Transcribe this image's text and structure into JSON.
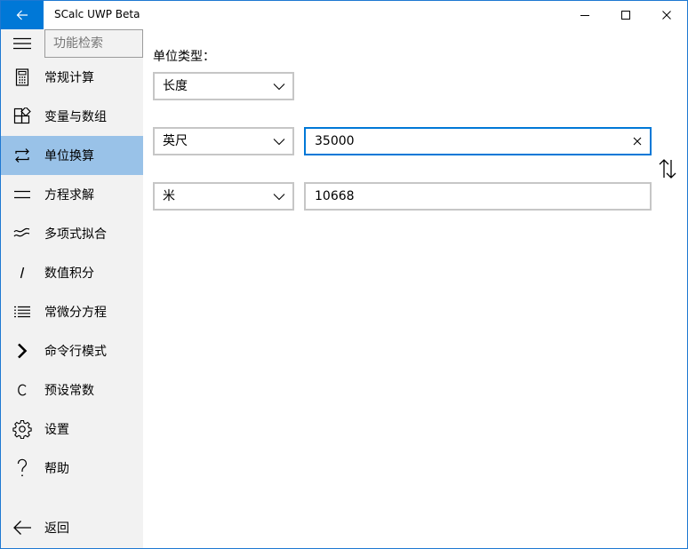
{
  "window": {
    "title": "SCalc UWP Beta",
    "accent_color": "#0078d7"
  },
  "titlebar": {
    "back_icon": "arrow-left-icon",
    "minimize_icon": "minimize-icon",
    "maximize_icon": "maximize-icon",
    "close_icon": "close-icon"
  },
  "sidebar": {
    "search_placeholder": "功能检索",
    "selected_color": "#99c2e8",
    "items": [
      {
        "label": "常规计算",
        "icon": "calculator-icon"
      },
      {
        "label": "变量与数组",
        "icon": "blocks-icon"
      },
      {
        "label": "单位换算",
        "icon": "convert-icon",
        "selected": true
      },
      {
        "label": "方程求解",
        "icon": "equals-icon"
      },
      {
        "label": "多项式拟合",
        "icon": "wave-icon"
      },
      {
        "label": "数值积分",
        "icon": "integral-icon"
      },
      {
        "label": "常微分方程",
        "icon": "list-icon"
      },
      {
        "label": "命令行模式",
        "icon": "chevron-right-icon"
      },
      {
        "label": "预设常数",
        "icon": "constant-c-icon"
      },
      {
        "label": "设置",
        "icon": "gear-icon"
      },
      {
        "label": "帮助",
        "icon": "question-icon"
      }
    ],
    "back_label": "返回"
  },
  "main": {
    "unit_type_label": "单位类型：",
    "unit_type_value": "长度",
    "from_unit": "英尺",
    "from_value": "35000",
    "to_unit": "米",
    "to_value": "10668"
  }
}
